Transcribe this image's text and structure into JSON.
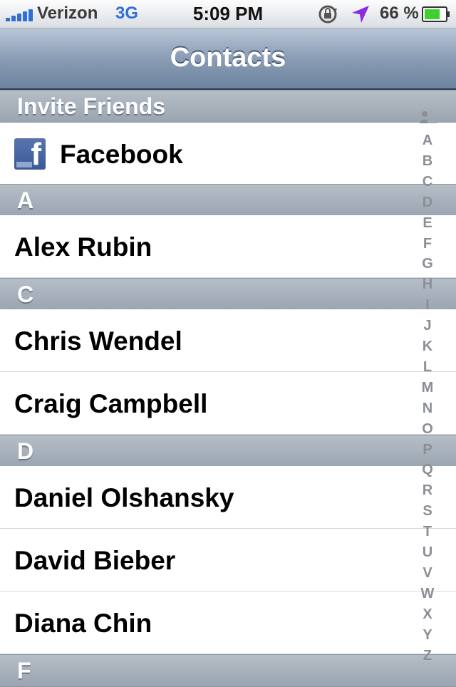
{
  "status_bar": {
    "carrier": "Verizon",
    "network": "3G",
    "time": "5:09 PM",
    "battery_percent": "66 %",
    "icons": [
      "signal-icon",
      "orientation-lock-icon",
      "location-icon",
      "battery-icon"
    ],
    "colors": {
      "accent": "#2f6fd6",
      "battery": "#3fcf2f"
    }
  },
  "nav_bar": {
    "title": "Contacts"
  },
  "list": {
    "sections": [
      {
        "header": "Invite Friends",
        "rows": [
          {
            "label": "Facebook",
            "icon": "facebook-icon"
          }
        ]
      },
      {
        "header": "A",
        "rows": [
          {
            "label": "Alex Rubin"
          }
        ]
      },
      {
        "header": "C",
        "rows": [
          {
            "label": "Chris Wendel"
          },
          {
            "label": "Craig Campbell"
          }
        ]
      },
      {
        "header": "D",
        "rows": [
          {
            "label": "Daniel Olshansky"
          },
          {
            "label": "David Bieber"
          },
          {
            "label": "Diana Chin"
          }
        ]
      },
      {
        "header": "F",
        "rows": []
      }
    ]
  },
  "index_bar": {
    "top_icon": "people-icon",
    "letters": [
      "A",
      "B",
      "C",
      "D",
      "E",
      "F",
      "G",
      "H",
      "I",
      "J",
      "K",
      "L",
      "M",
      "N",
      "O",
      "P",
      "Q",
      "R",
      "S",
      "T",
      "U",
      "V",
      "W",
      "X",
      "Y",
      "Z"
    ]
  }
}
